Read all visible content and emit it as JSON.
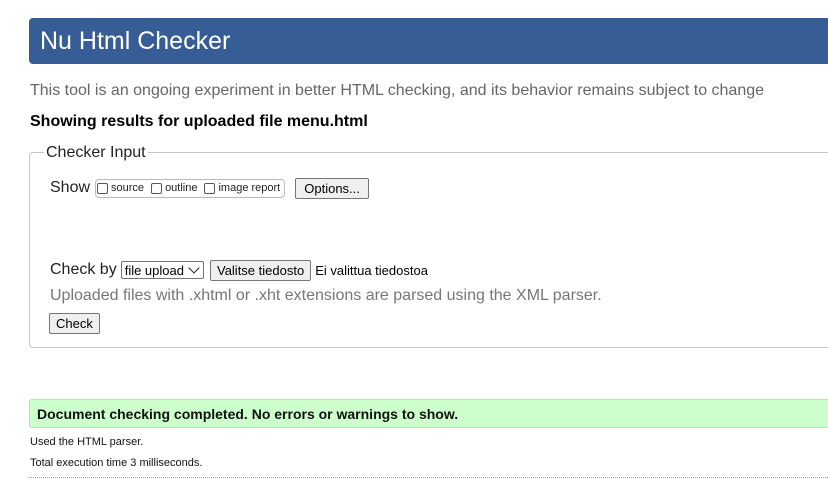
{
  "header": {
    "title": "Nu Html Checker"
  },
  "tagline": "This tool is an ongoing experiment in better HTML checking, and its behavior remains subject to change",
  "results_heading": "Showing results for uploaded file menu.html",
  "checker_input": {
    "legend": "Checker Input",
    "show_label": "Show",
    "show_options": [
      {
        "label": "source",
        "checked": false
      },
      {
        "label": "outline",
        "checked": false
      },
      {
        "label": "image report",
        "checked": false
      }
    ],
    "options_button": "Options...",
    "check_by_label": "Check by",
    "check_by_selected": "file upload",
    "file_button": "Valitse tiedosto",
    "file_status": "Ei valittua tiedostoa",
    "xml_note": "Uploaded files with .xhtml or .xht extensions are parsed using the XML parser.",
    "check_button": "Check"
  },
  "result": {
    "success_message": "Document checking completed. No errors or warnings to show.",
    "parser_note": "Used the HTML parser.",
    "execution_note": "Total execution time 3 milliseconds."
  },
  "colors": {
    "header_bg": "#365d95",
    "success_bg": "#ccffcc"
  }
}
